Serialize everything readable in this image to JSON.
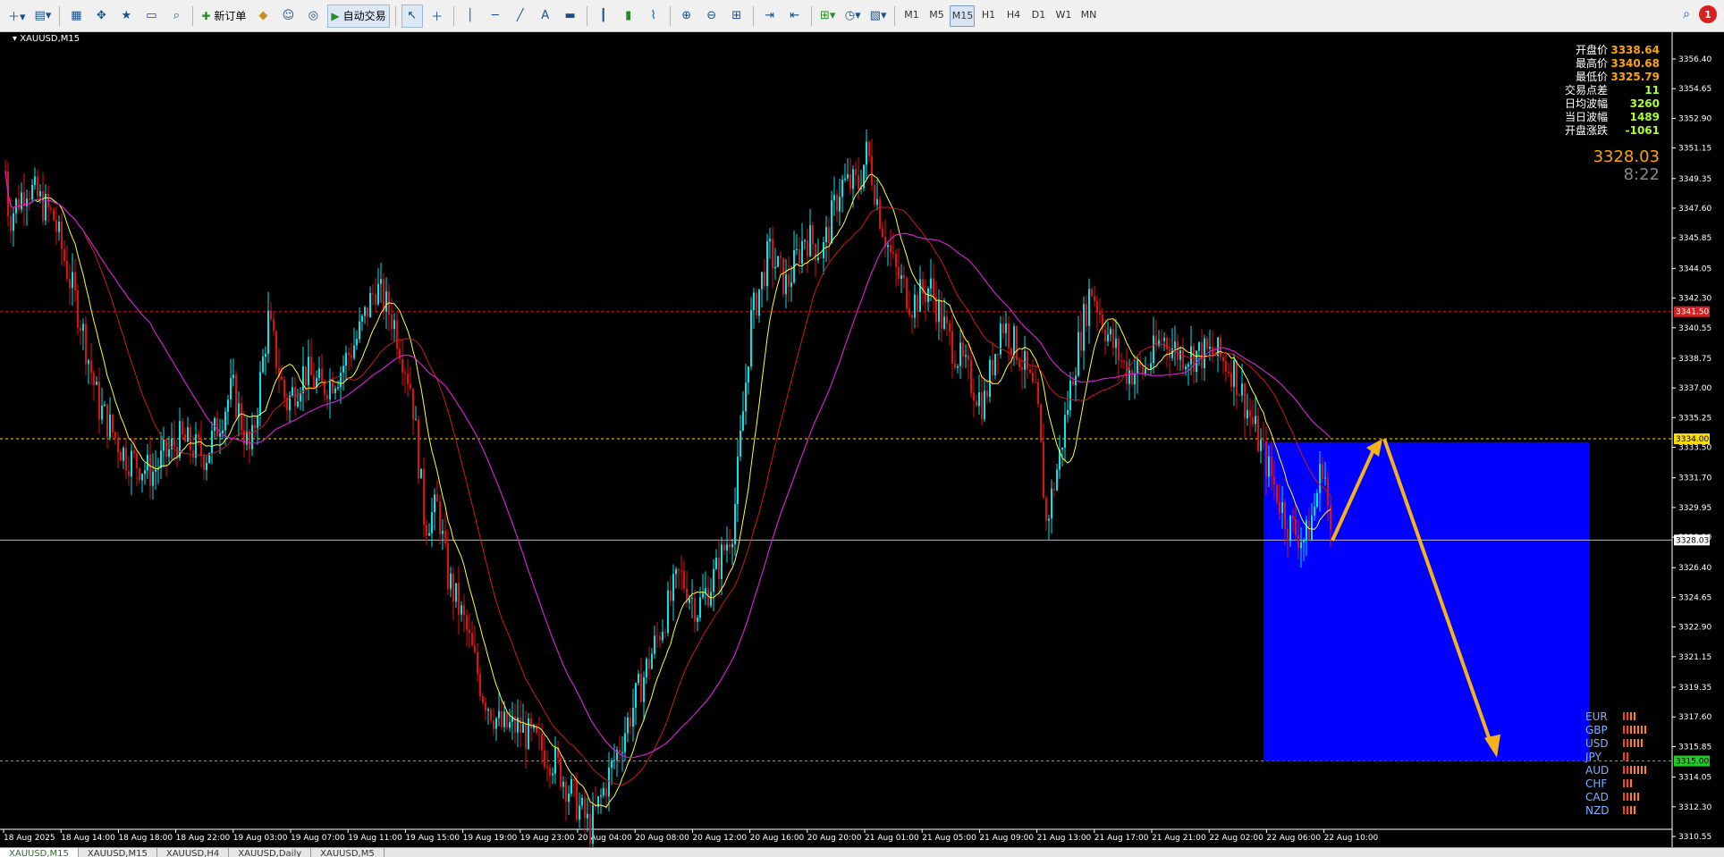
{
  "toolbar": {
    "new_order_label": "新订单",
    "auto_trading_label": "自动交易",
    "timeframes": [
      "M1",
      "M5",
      "M15",
      "H1",
      "H4",
      "D1",
      "W1",
      "MN"
    ],
    "active_timeframe": "M15",
    "alert_count": "1"
  },
  "chart": {
    "symbol_label": "XAUUSD,M15",
    "info_panel": [
      {
        "label": "开盘价",
        "value": "3338.64"
      },
      {
        "label": "最高价",
        "value": "3340.68"
      },
      {
        "label": "最低价",
        "value": "3325.79"
      },
      {
        "label": "交易点差",
        "value": "11"
      },
      {
        "label": "日均波幅",
        "value": "3260"
      },
      {
        "label": "当日波幅",
        "value": "1489"
      },
      {
        "label": "开盘涨跌",
        "value": "-1061"
      }
    ],
    "current_price": "3328.03",
    "countdown": "8:22",
    "price_axis_labels": [
      "3356.40",
      "3354.65",
      "3352.90",
      "3351.15",
      "3349.35",
      "3347.60",
      "3345.85",
      "3344.05",
      "3342.30",
      "3340.55",
      "3338.75",
      "3337.00",
      "3335.25",
      "3333.50",
      "3331.70",
      "3329.95",
      "3328.20",
      "3326.40",
      "3324.65",
      "3322.90",
      "3321.15",
      "3319.35",
      "3317.60",
      "3315.85",
      "3314.05",
      "3312.30",
      "3310.55"
    ],
    "price_tags": [
      {
        "price": 3341.5,
        "text": "3341.50",
        "color": "#d42020",
        "text_color": "#ffffff"
      },
      {
        "price": 3334.0,
        "text": "3334.00",
        "color": "#ffdd00",
        "text_color": "#000000"
      },
      {
        "price": 3328.03,
        "text": "3328.03",
        "color": "#ffffff",
        "text_color": "#000000"
      },
      {
        "price": 3315.0,
        "text": "3315.00",
        "color": "#22cc22",
        "text_color": "#000000"
      }
    ],
    "time_axis_labels": [
      "18 Aug 2025",
      "18 Aug 14:00",
      "18 Aug 18:00",
      "18 Aug 22:00",
      "19 Aug 03:00",
      "19 Aug 07:00",
      "19 Aug 11:00",
      "19 Aug 15:00",
      "19 Aug 19:00",
      "19 Aug 23:00",
      "20 Aug 04:00",
      "20 Aug 08:00",
      "20 Aug 12:00",
      "20 Aug 16:00",
      "20 Aug 20:00",
      "21 Aug 01:00",
      "21 Aug 05:00",
      "21 Aug 09:00",
      "21 Aug 13:00",
      "21 Aug 17:00",
      "21 Aug 21:00",
      "22 Aug 02:00",
      "22 Aug 06:00",
      "22 Aug 10:00"
    ],
    "currency_strength": [
      {
        "name": "EUR",
        "bars": 4
      },
      {
        "name": "GBP",
        "bars": 7
      },
      {
        "name": "USD",
        "bars": 6
      },
      {
        "name": "JPY",
        "bars": 2
      },
      {
        "name": "AUD",
        "bars": 7
      },
      {
        "name": "CHF",
        "bars": 3
      },
      {
        "name": "CAD",
        "bars": 5
      },
      {
        "name": "NZD",
        "bars": 4
      }
    ],
    "colors": {
      "background": "#000000",
      "bull": "#00e5ee",
      "bear": "#e01010",
      "ma_fast": "#ffff33",
      "ma_mid": "#cc1a1a",
      "ma_slow": "#cc22cc",
      "zone": "#0000ff",
      "arrow": "#f5b21b",
      "panel_label": "#ffffff",
      "panel_value_orange": "#ffa500",
      "panel_value_green": "#adff2f"
    }
  },
  "bottom_tabs": [
    "XAUUSD,M15",
    "XAUUSD,M15",
    "XAUUSD,H4",
    "XAUUSD,Daily",
    "XAUUSD,M5"
  ]
}
